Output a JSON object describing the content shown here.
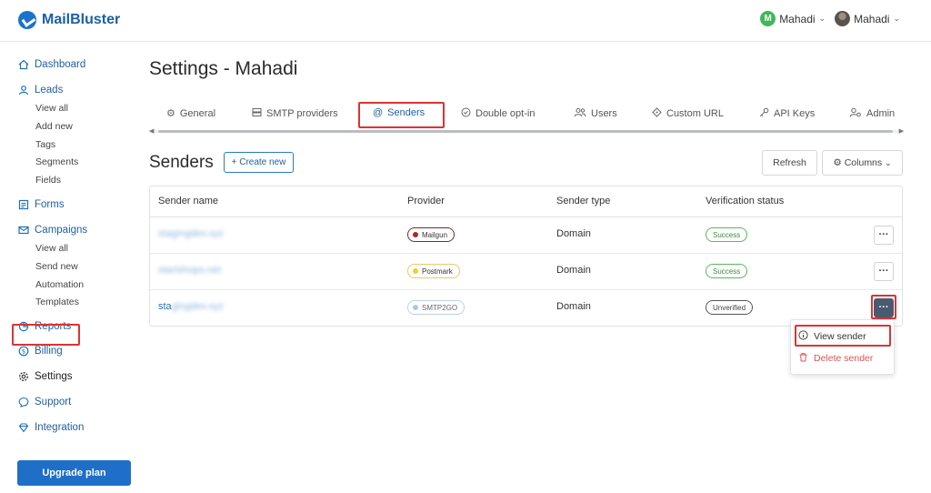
{
  "app": {
    "name": "MailBluster",
    "brand_color": "#1f6fc9",
    "highlight_color": "#dd3333"
  },
  "header": {
    "workspace_user": {
      "initial": "M",
      "name": "Mahadi"
    },
    "account_user": {
      "name": "Mahadi"
    }
  },
  "sidebar": {
    "dashboard": "Dashboard",
    "leads": "Leads",
    "leads_sub": [
      "View all",
      "Add new",
      "Tags",
      "Segments",
      "Fields"
    ],
    "forms": "Forms",
    "campaigns": "Campaigns",
    "campaigns_sub": [
      "View all",
      "Send new",
      "Automation",
      "Templates"
    ],
    "reports": "Reports",
    "billing": "Billing",
    "settings": "Settings",
    "support": "Support",
    "integration": "Integration",
    "upgrade": "Upgrade plan"
  },
  "page": {
    "title": "Settings - Mahadi"
  },
  "tabs": {
    "general": "General",
    "smtp": "SMTP providers",
    "senders": "Senders",
    "double_opt_in": "Double opt-in",
    "users": "Users",
    "custom_url": "Custom URL",
    "api_keys": "API Keys",
    "admin": "Admin"
  },
  "senders": {
    "title": "Senders",
    "create_new": "+ Create new",
    "refresh": "Refresh",
    "columns": "Columns",
    "headers": {
      "sender_name": "Sender name",
      "provider": "Provider",
      "sender_type": "Sender type",
      "verification_status": "Verification status"
    },
    "rows": [
      {
        "name": "stagingdev.xyz",
        "provider": "Mailgun",
        "provider_color": "#a52a2a",
        "type": "Domain",
        "status": "Success"
      },
      {
        "name": "startshops.net",
        "provider": "Postmark",
        "provider_color": "#f2cf2a",
        "type": "Domain",
        "status": "Success"
      },
      {
        "name_visible": "sta",
        "name_hidden": "gingdev.xyz",
        "provider": "SMTP2GO",
        "provider_color": "#a9c9ea",
        "type": "Domain",
        "status": "Unverified"
      }
    ],
    "more_label": "···"
  },
  "dropdown": {
    "view": "View sender",
    "delete": "Delete sender"
  }
}
